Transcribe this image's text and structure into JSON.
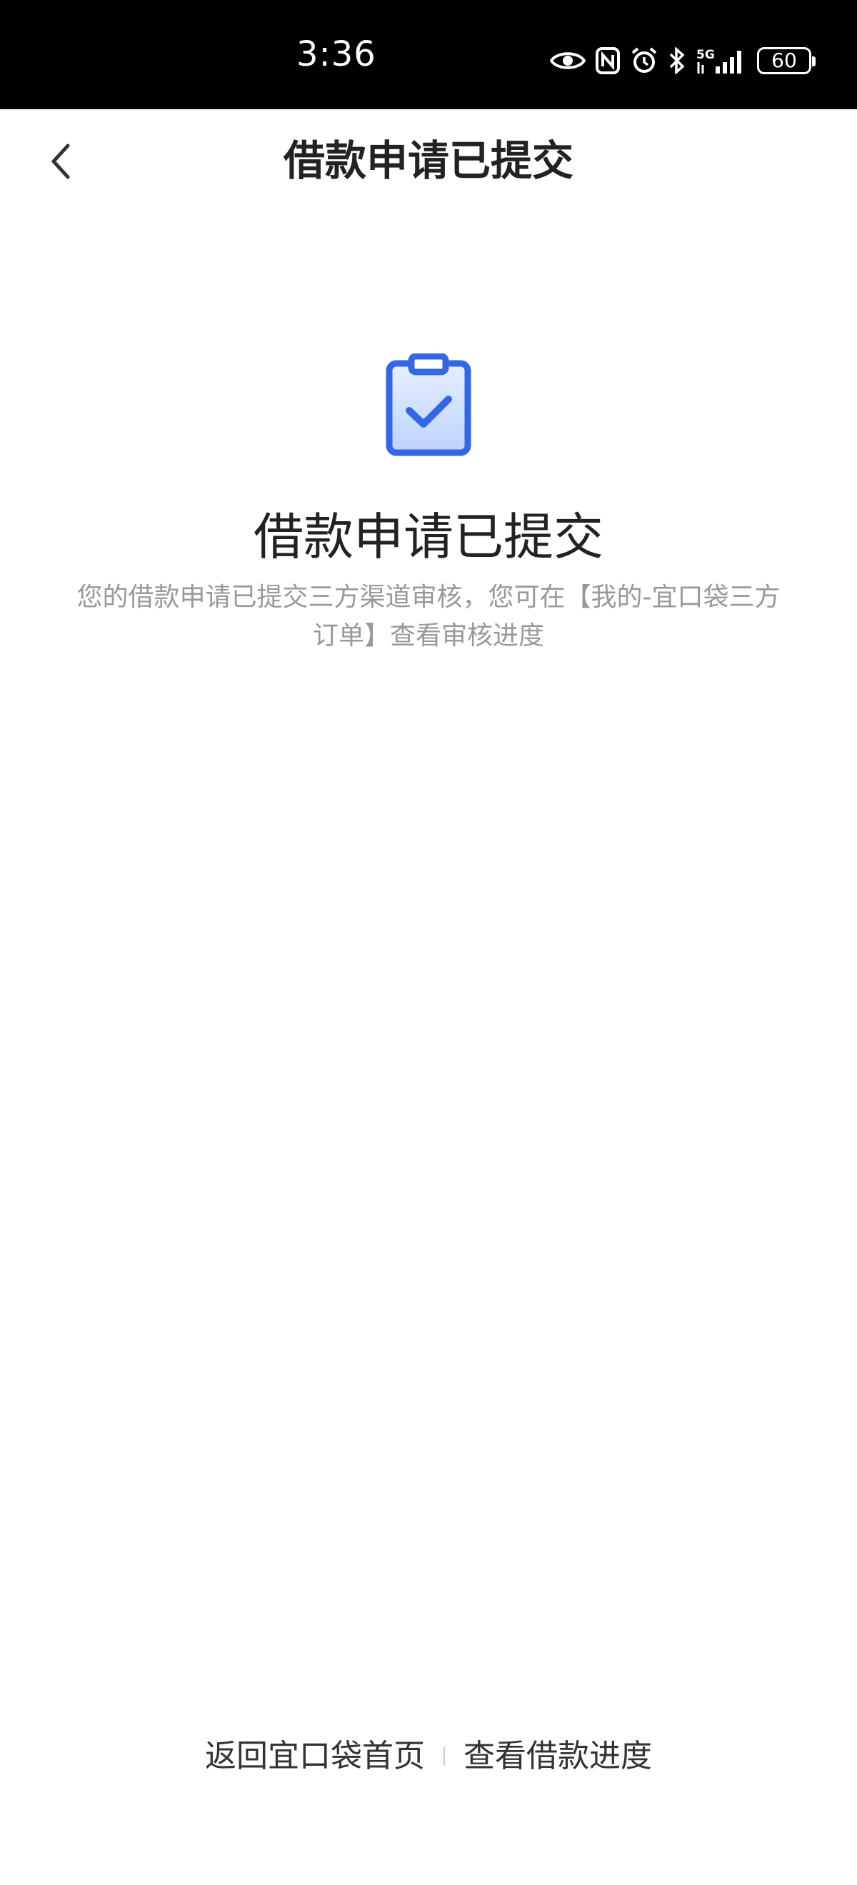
{
  "status_bar": {
    "time": "3:36",
    "battery": "60",
    "network": "5G",
    "icons": [
      "eye-icon",
      "nfc-icon",
      "alarm-icon",
      "bluetooth-icon",
      "signal-icon",
      "battery-icon"
    ]
  },
  "nav": {
    "title": "借款申请已提交",
    "back_icon": "chevron-left-icon"
  },
  "result": {
    "icon": "clipboard-check-icon",
    "title": "借款申请已提交",
    "description": "您的借款申请已提交三方渠道审核，您可在【我的-宜口袋三方订单】查看审核进度"
  },
  "footer": {
    "home_link": "返回宜口袋首页",
    "progress_link": "查看借款进度"
  },
  "colors": {
    "accent": "#3466e8",
    "icon_fill": "#c9dcff",
    "text_primary": "#222222",
    "text_secondary": "#999999",
    "status_bar_bg": "#000000"
  }
}
